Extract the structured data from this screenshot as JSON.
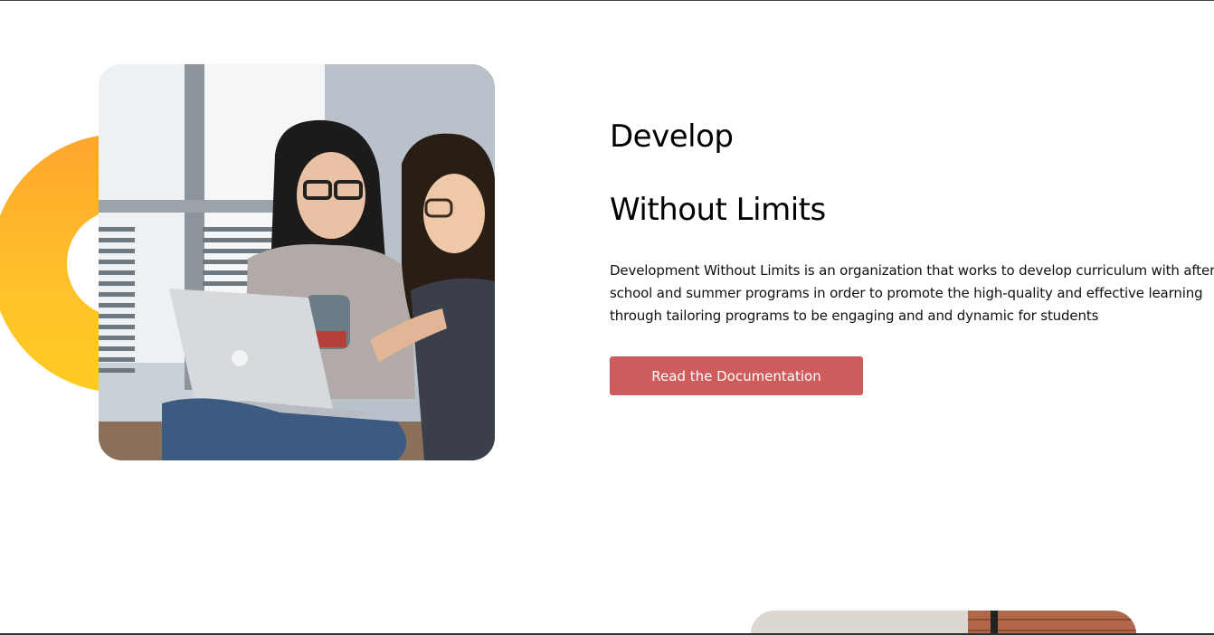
{
  "hero": {
    "heading_line1": "Develop",
    "heading_line2": "Without Limits",
    "description": "Development Without Limits is an organization that works to develop curriculum with after school and summer programs in order to promote the high-quality and effective learning through tailoring programs to be engaging and and dynamic for students",
    "cta_label": "Read the Documentation"
  },
  "colors": {
    "accent_button": "#cf5c5c",
    "ring_top": "#ffa52e",
    "ring_bottom": "#ffcc22",
    "text": "#000000",
    "background": "#ffffff"
  },
  "images": {
    "hero_photo": "two-students-with-laptop-photo",
    "next_section_photo": "brick-wall-room-photo"
  }
}
